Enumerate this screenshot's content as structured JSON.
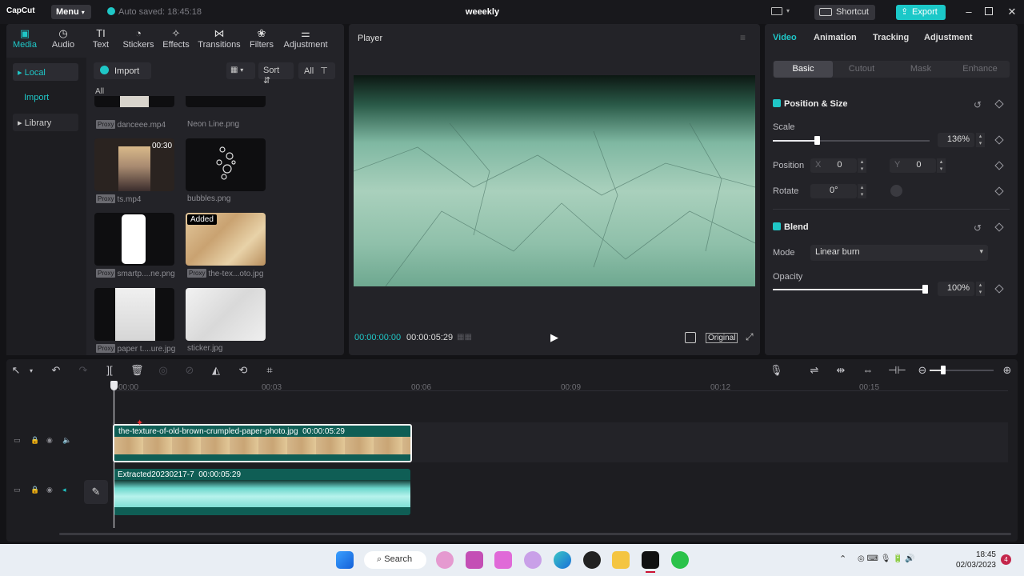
{
  "app": {
    "logo": "CapCut",
    "menu": "Menu",
    "autosave": "Auto saved: 18:45:18",
    "project_title": "weeekly",
    "shortcut": "Shortcut",
    "export": "Export"
  },
  "media_tabs": [
    {
      "label": "Media",
      "icon": "media-icon",
      "active": true
    },
    {
      "label": "Audio",
      "icon": "audio-icon"
    },
    {
      "label": "Text",
      "icon": "text-icon"
    },
    {
      "label": "Stickers",
      "icon": "stickers-icon"
    },
    {
      "label": "Effects",
      "icon": "effects-icon"
    },
    {
      "label": "Transitions",
      "icon": "transitions-icon"
    },
    {
      "label": "Filters",
      "icon": "filters-icon"
    },
    {
      "label": "Adjustment",
      "icon": "adjustment-icon"
    }
  ],
  "sidebar": {
    "local": "Local",
    "import": "Import",
    "library": "Library"
  },
  "media_toolbar": {
    "import": "Import",
    "sort": "Sort",
    "all": "All",
    "section": "All"
  },
  "media_items": [
    {
      "name": "danceee.mp4",
      "proxy": "Proxy"
    },
    {
      "name": "Neon Line.png"
    },
    {
      "name": "ts.mp4",
      "proxy": "Proxy",
      "duration": "00:30"
    },
    {
      "name": "bubbles.png"
    },
    {
      "name": "smartp....ne.png",
      "proxy": "Proxy"
    },
    {
      "name": "the-tex...oto.jpg",
      "proxy": "Proxy",
      "badge": "Added"
    },
    {
      "name": "paper t....ure.jpg",
      "proxy": "Proxy"
    },
    {
      "name": "sticker.jpg"
    }
  ],
  "player": {
    "title": "Player",
    "current_time": "00:00:00:00",
    "total_time": "00:00:05:29",
    "original": "Original"
  },
  "right_panel": {
    "tabs": [
      "Video",
      "Animation",
      "Tracking",
      "Adjustment"
    ],
    "subtabs": [
      "Basic",
      "Cutout",
      "Mask",
      "Enhance"
    ],
    "position_size": "Position & Size",
    "scale_label": "Scale",
    "scale_value": "136%",
    "scale_fraction": 0.28,
    "position_label": "Position",
    "x_label": "X",
    "x_value": "0",
    "y_label": "Y",
    "y_value": "0",
    "rotate_label": "Rotate",
    "rotate_value": "0°",
    "blend": "Blend",
    "mode_label": "Mode",
    "mode_value": "Linear burn",
    "opacity_label": "Opacity",
    "opacity_value": "100%",
    "opacity_fraction": 1.0
  },
  "timeline": {
    "ruler": [
      "00:00",
      "00:03",
      "00:06",
      "00:09",
      "00:12",
      "00:15"
    ],
    "clip1": {
      "name": "the-texture-of-old-brown-crumpled-paper-photo.jpg",
      "duration": "00:00:05:29"
    },
    "clip2": {
      "name": "Extracted20230217-7",
      "duration": "00:00:05:29"
    }
  },
  "taskbar": {
    "search": "Search",
    "time": "18:45",
    "date": "02/03/2023",
    "notifications": "4"
  },
  "colors": {
    "accent": "#1fc7c7",
    "panel": "#232328",
    "background": "#131316",
    "clip_teal": "#0f5e55"
  }
}
